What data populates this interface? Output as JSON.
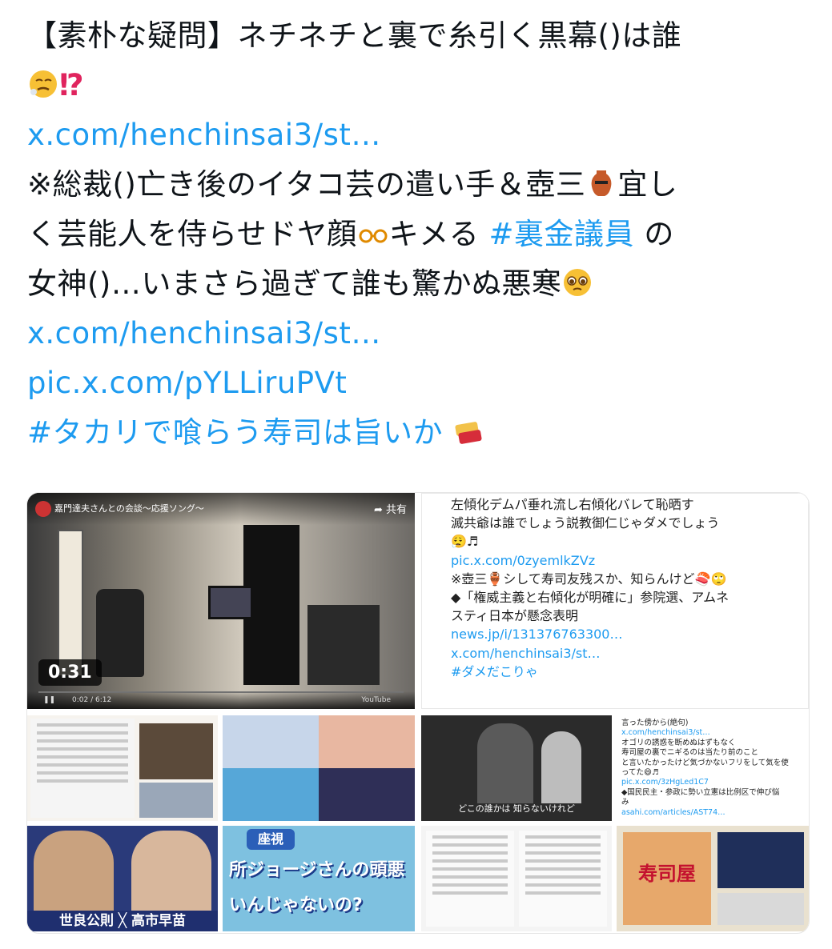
{
  "tweet": {
    "line1": "【素朴な疑問】ネチネチと裏で糸引く黒幕()は誰",
    "line2_mark": "⁉",
    "link1": "x.com/henchinsai3/st…",
    "line4": "※総裁()亡き後のイタコ芸の遣い手＆壺三",
    "line4_end": "宜し",
    "line5a": "く芸能人を侍らせドヤ顔",
    "line5b": "キメる",
    "line5_hashtag": "#裏金議員",
    "line5c": "の",
    "line6": "女神()…いまさら過ぎて誰も驚かぬ悪寒",
    "link2": "x.com/henchinsai3/st…",
    "link3": "pic.x.com/pYLLiruPVt",
    "hashtag2": "#タカリで喰らう寿司は旨いか"
  },
  "video": {
    "title": "嘉門達夫さんとの会談〜応援ソング〜",
    "share": "共有",
    "duration": "0:31",
    "time": "0:02 / 6:12",
    "brand": "YouTube"
  },
  "textcard": {
    "lines": [
      {
        "text": "左傾化デムパ垂れ流し右傾化バレて恥晒す",
        "link": false
      },
      {
        "text": "滅共爺は誰でしょう説教御仁じゃダメでしょう",
        "link": false
      },
      {
        "text": "😮‍💨♬",
        "link": false
      },
      {
        "text": "pic.x.com/0zyemlkZVz",
        "link": true
      },
      {
        "text": "※壺三🏺シして寿司友残スか、知らんけど🍣🙄",
        "link": false
      },
      {
        "text": "◆「権威主義と右傾化が明確に」参院選、アムネ",
        "link": false
      },
      {
        "text": "スティ日本が懸念表明",
        "link": false
      },
      {
        "text": "news.jp/i/131376763300…",
        "link": true
      },
      {
        "text": "x.com/henchinsai3/st…",
        "link": true
      },
      {
        "text": "#ダメだこりゃ",
        "link": true
      }
    ]
  },
  "grid1": {
    "names_label": "世良公則 ╳ 高市早苗",
    "caption_bottom": "所ジョージさんの頭悪いんじゃないの?",
    "caption_top": "座視"
  },
  "grid2": {
    "tv_caption": "どこの誰かは 知らないけれど",
    "card_lines": [
      "言った傍から(絶句)",
      "x.com/henchinsai3/st…",
      "オゴリの誘惑を断めぬはずもなく",
      "寿司屋の裏でニギるのは当たり前のこと",
      "と言いたかったけど気づかないフリをして気を使",
      "ってた😄♬",
      "pic.x.com/3zHgLed1C7",
      "◆国民民主・参政に勢い立憲は比例区で伸び悩",
      "み",
      "asahi.com/articles/AST74…"
    ],
    "sushi_sign": "寿司屋"
  }
}
